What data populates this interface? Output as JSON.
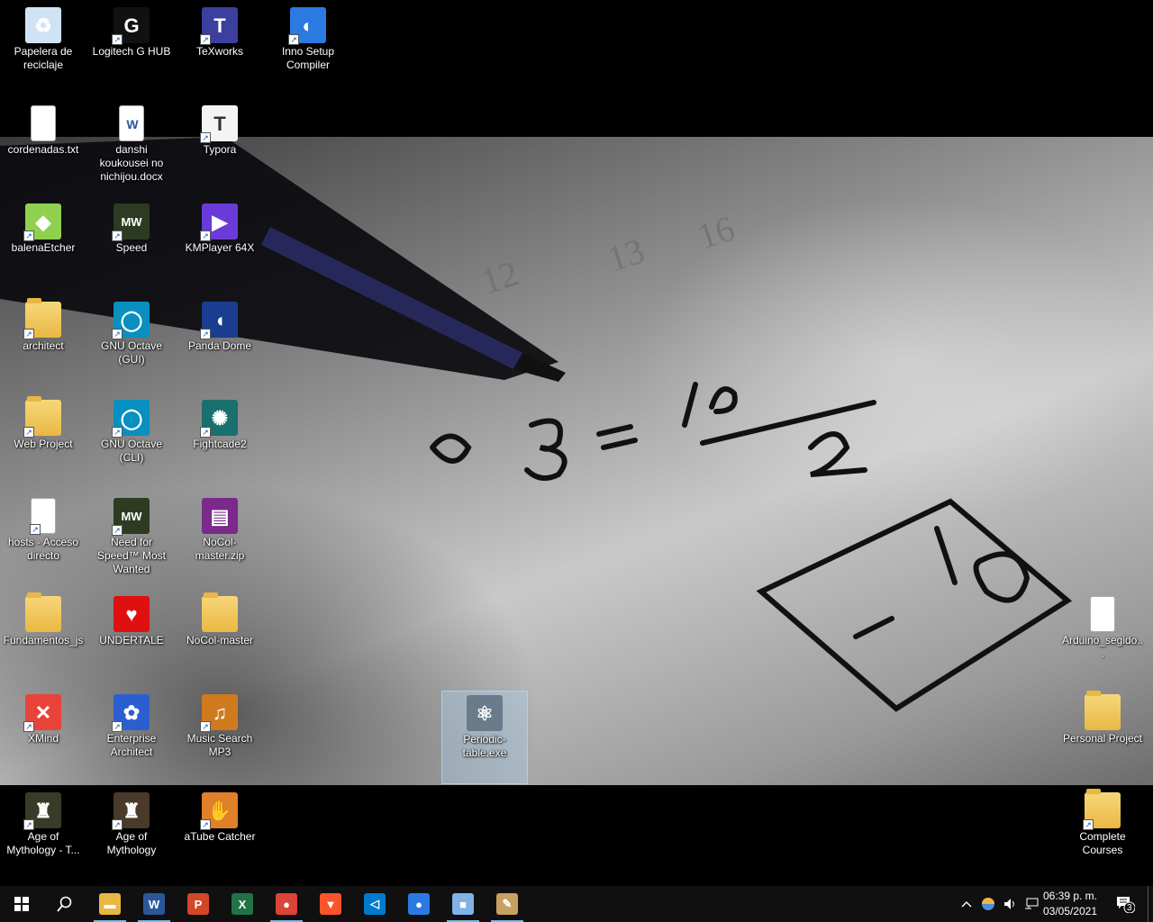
{
  "desktop": {
    "icons": [
      {
        "label": "Papelera de reciclaje",
        "icon": "recycle-bin-icon"
      },
      {
        "label": "Logitech G HUB",
        "icon": "logitech-icon"
      },
      {
        "label": "TeXworks",
        "icon": "texworks-icon"
      },
      {
        "label": "Inno Setup Compiler",
        "icon": "inno-setup-icon"
      },
      {
        "label": "cordenadas.txt",
        "icon": "text-file-icon"
      },
      {
        "label": "danshi koukousei no nichijou.docx",
        "icon": "word-document-icon"
      },
      {
        "label": "Typora",
        "icon": "typora-icon"
      },
      {
        "label": "balenaEtcher",
        "icon": "balena-etcher-icon"
      },
      {
        "label": "Speed",
        "icon": "nfs-speed-icon"
      },
      {
        "label": "KMPlayer 64X",
        "icon": "kmplayer-icon"
      },
      {
        "label": "architect",
        "icon": "folder-shortcut-icon"
      },
      {
        "label": "GNU Octave (GUI)",
        "icon": "octave-icon"
      },
      {
        "label": "Panda Dome",
        "icon": "panda-dome-icon"
      },
      {
        "label": "Web Project",
        "icon": "folder-shortcut-icon"
      },
      {
        "label": "GNU Octave (CLI)",
        "icon": "octave-icon"
      },
      {
        "label": "Fightcade2",
        "icon": "fightcade-icon"
      },
      {
        "label": "hosts - Acceso directo",
        "icon": "file-shortcut-icon"
      },
      {
        "label": "Need for Speed™ Most Wanted",
        "icon": "nfs-most-wanted-icon"
      },
      {
        "label": "NoCol-master.zip",
        "icon": "winrar-archive-icon"
      },
      {
        "label": "Fundamentos_js",
        "icon": "folder-icon"
      },
      {
        "label": "UNDERTALE",
        "icon": "undertale-heart-icon"
      },
      {
        "label": "NoCol-master",
        "icon": "folder-icon"
      },
      {
        "label": "XMind",
        "icon": "xmind-icon"
      },
      {
        "label": "Enterprise Architect",
        "icon": "enterprise-architect-icon"
      },
      {
        "label": "Music Search MP3",
        "icon": "music-search-icon"
      },
      {
        "label": "Periodic-table.exe",
        "icon": "atom-icon"
      },
      {
        "label": "Age of Mythology - T...",
        "icon": "age-of-mythology-titans-icon"
      },
      {
        "label": "Age of Mythology",
        "icon": "age-of-mythology-icon"
      },
      {
        "label": "aTube Catcher",
        "icon": "atube-catcher-icon"
      },
      {
        "label": "Arduino_segido...",
        "icon": "text-file-icon"
      },
      {
        "label": "Personal Project",
        "icon": "folder-icon"
      },
      {
        "label": "Complete Courses",
        "icon": "folder-shortcut-icon"
      }
    ]
  },
  "taskbar": {
    "start_icon": "windows-start-icon",
    "search_icon": "search-icon",
    "apps": [
      {
        "name": "file-explorer",
        "icon": "folder-icon",
        "glyph": "▬",
        "color": "#e9b843",
        "running": true
      },
      {
        "name": "word",
        "icon": "word-icon",
        "glyph": "W",
        "color": "#2b579a",
        "running": true
      },
      {
        "name": "powerpoint",
        "icon": "powerpoint-icon",
        "glyph": "P",
        "color": "#d24726",
        "running": false
      },
      {
        "name": "excel",
        "icon": "excel-icon",
        "glyph": "X",
        "color": "#217346",
        "running": false
      },
      {
        "name": "chrome",
        "icon": "chrome-icon",
        "glyph": "●",
        "color": "#db4437",
        "running": true
      },
      {
        "name": "brave",
        "icon": "brave-icon",
        "glyph": "▼",
        "color": "#fb542b",
        "running": false
      },
      {
        "name": "vscode",
        "icon": "vscode-icon",
        "glyph": "◁",
        "color": "#007acc",
        "running": false
      },
      {
        "name": "firefox",
        "icon": "firefox-icon",
        "glyph": "●",
        "color": "#2a7ae2",
        "running": false
      },
      {
        "name": "virtualbox",
        "icon": "cube-icon",
        "glyph": "■",
        "color": "#7fb2e5",
        "running": true
      },
      {
        "name": "paint",
        "icon": "paint-palette-icon",
        "glyph": "✎",
        "color": "#c8a060",
        "running": true
      }
    ],
    "tray": {
      "chevron_icon": "chevron-up-icon",
      "weather_icon": "weather-icon",
      "volume_icon": "volume-icon",
      "network_icon": "network-icon",
      "notification_count": "3"
    },
    "clock": {
      "time": "06:39 p. m.",
      "date": "03/05/2021"
    }
  }
}
